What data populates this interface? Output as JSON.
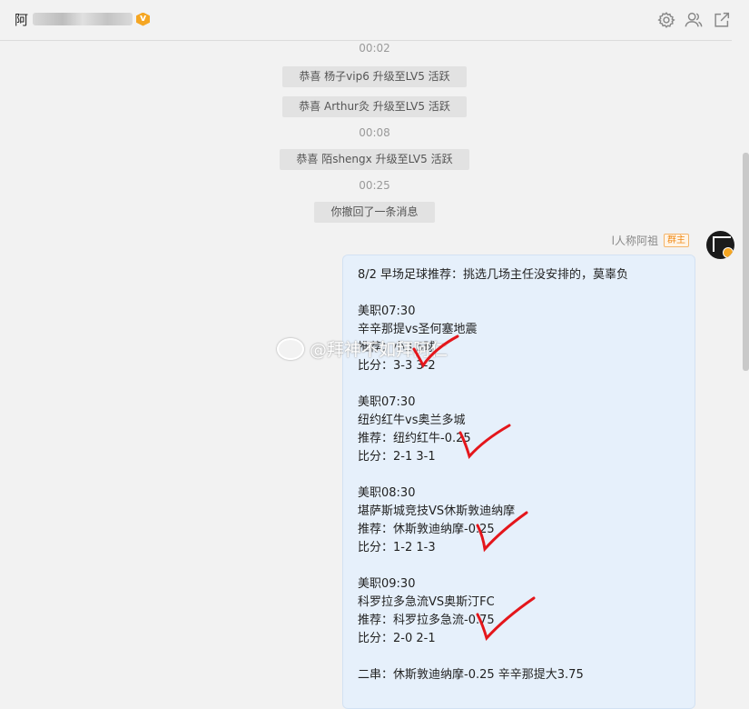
{
  "header": {
    "title": "阿",
    "icons": [
      "gear-icon",
      "group-icon",
      "external-link-icon"
    ]
  },
  "messages": {
    "t1": "00:02",
    "s1": "恭喜 杨子vip6 升级至LV5 活跃",
    "s2": "恭喜 Arthur灸 升级至LV5 活跃",
    "t2": "00:08",
    "s3": "恭喜 陌shengx 升级至LV5 活跃",
    "t3": "00:25",
    "s4": "你撤回了一条消息"
  },
  "sender": {
    "name": "l人称阿祖",
    "badge": "群主"
  },
  "bubble": {
    "lines": [
      "8/2 早场足球推荐：挑选几场主任没安排的，莫辜负",
      "",
      "美职07:30",
      "辛辛那提vs圣何塞地震",
      "推荐：小3.5球",
      "比分：3-3 3-2",
      "",
      "美职07:30",
      "纽约红牛vs奥兰多城",
      "推荐：纽约红牛-0.25",
      "比分：2-1 3-1",
      "",
      "美职08:30",
      "堪萨斯城竞技VS休斯敦迪纳摩",
      "推荐：休斯敦迪纳摩-0.25",
      "比分：1-2 1-3",
      "",
      "美职09:30",
      "科罗拉多急流VS奥斯汀FC",
      "推荐：科罗拉多急流-0.75",
      "比分：2-0 2-1",
      "",
      "二串：休斯敦迪纳摩-0.25 辛辛那提大3.75"
    ]
  },
  "watermark": "@拜神不如拜阿仁",
  "colors": {
    "bubble": "#e6f0fb",
    "check": "#e4161b",
    "badge": "#f08b1a"
  }
}
